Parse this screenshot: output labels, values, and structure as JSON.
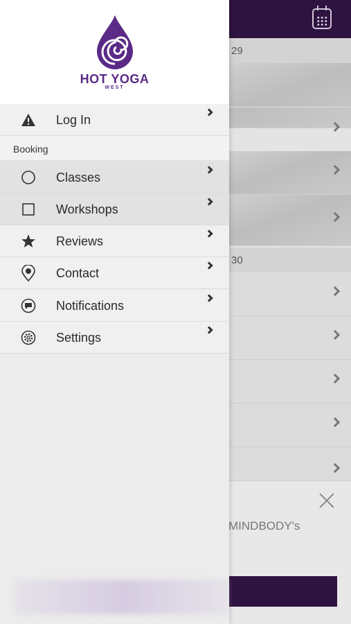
{
  "background": {
    "dates": [
      "29",
      "30"
    ],
    "banner_text": "MINDBODY's"
  },
  "brand": {
    "name": "HOT YOGA",
    "sub": "WEST",
    "color": "#5b2a86"
  },
  "menu": {
    "login": "Log In",
    "section": "Booking",
    "items": [
      {
        "label": "Classes",
        "icon": "circle-icon"
      },
      {
        "label": "Workshops",
        "icon": "square-icon"
      },
      {
        "label": "Reviews",
        "icon": "star-icon"
      },
      {
        "label": "Contact",
        "icon": "location-pin-icon"
      },
      {
        "label": "Notifications",
        "icon": "chat-bubble-icon"
      },
      {
        "label": "Settings",
        "icon": "gear-icon"
      }
    ]
  }
}
